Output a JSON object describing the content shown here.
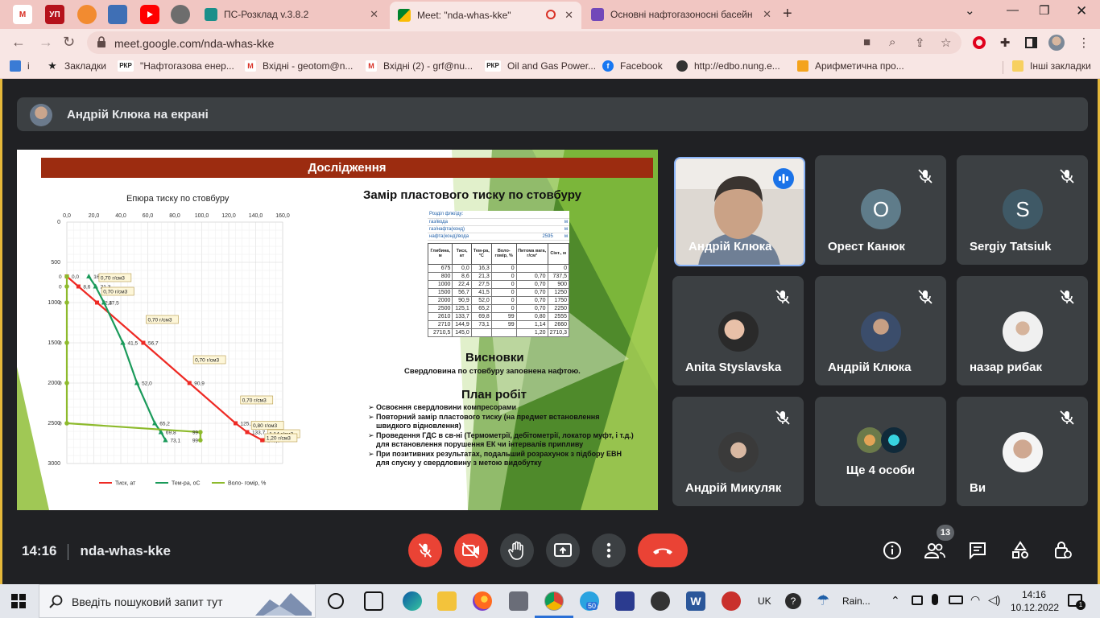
{
  "browser": {
    "tabs": [
      {
        "title": "ПС-Розклад v.3.8.2",
        "active": false
      },
      {
        "title": "Meet: \"nda-whas-kke\"",
        "active": true
      },
      {
        "title": "Основні нафтогазоносні басейн",
        "active": false
      }
    ],
    "pinned_labels": [
      "M",
      "УП",
      "",
      "",
      "",
      ""
    ],
    "url": "meet.google.com/nda-whas-kke",
    "bookmarks": [
      {
        "label": "і",
        "icon": "apps-icon"
      },
      {
        "label": "Закладки",
        "icon": "star-icon"
      },
      {
        "label": "\"Нафтогазова енер...",
        "icon": "РКР"
      },
      {
        "label": "Вхідні - geotom@n...",
        "icon": "M"
      },
      {
        "label": "Вхідні (2) - grf@nu...",
        "icon": "M"
      },
      {
        "label": "Oil and Gas Power...",
        "icon": "РКР"
      },
      {
        "label": "Facebook",
        "icon": "facebook-icon"
      },
      {
        "label": "http://edbo.nung.e...",
        "icon": "globe-icon"
      },
      {
        "label": "Арифметична про...",
        "icon": "vr-icon"
      },
      {
        "label": "Інші закладки",
        "icon": "folder-icon"
      }
    ]
  },
  "meet": {
    "presenter_banner": "Андрій Клюка на екрані",
    "meeting_code": "nda-whas-kke",
    "time": "14:16",
    "participants_count": "13",
    "tiles": [
      {
        "name": "Андрій Клюка",
        "type": "video",
        "speaking": true
      },
      {
        "name": "Орест Канюк",
        "type": "letter",
        "letter": "О",
        "color": "#5f7c8a",
        "muted": true
      },
      {
        "name": "Sergiy Tatsiuk",
        "type": "letter",
        "letter": "S",
        "color": "#3f5966",
        "muted": true
      },
      {
        "name": "Anita Styslavska",
        "type": "photo",
        "muted": true
      },
      {
        "name": "Андрій Клюка",
        "type": "photo",
        "muted": true
      },
      {
        "name": "назар рибак",
        "type": "photo",
        "muted": true
      },
      {
        "name": "Андрій Микуляк",
        "type": "photo",
        "muted": true
      },
      {
        "name": "Ще 4 особи",
        "type": "group",
        "muted": false
      },
      {
        "name": "Ви",
        "type": "photo",
        "muted": true
      }
    ]
  },
  "slide": {
    "header": "Дослідження",
    "chart_title": "Епюра тиску по стовбуру",
    "right_title": "Замір пластового тиску по стовбуру",
    "table_header_rows": [
      [
        "Розділ флюїду:",
        "",
        ""
      ],
      [
        "газ/вода",
        "",
        "м"
      ],
      [
        "газ/нафта(конд)",
        "",
        "м"
      ],
      [
        "нафта(конд)/вода",
        "2595",
        "м"
      ]
    ],
    "table_columns": [
      "Глибина, м",
      "Тиск, ат",
      "Тем-ра, °С",
      "Воло-гоміp, %",
      "Питома вага, г/см³",
      "Сінт., м"
    ],
    "table_rows": [
      [
        "675",
        "0,0",
        "16,3",
        "0",
        "",
        "0"
      ],
      [
        "800",
        "8,6",
        "21,3",
        "0",
        "0,70",
        "737,5"
      ],
      [
        "1000",
        "22,4",
        "27,5",
        "0",
        "0,70",
        "900"
      ],
      [
        "1500",
        "56,7",
        "41,5",
        "0",
        "0,70",
        "1250"
      ],
      [
        "2000",
        "90,9",
        "52,0",
        "0",
        "0,70",
        "1750"
      ],
      [
        "2500",
        "125,1",
        "65,2",
        "0",
        "0,70",
        "2250"
      ],
      [
        "2610",
        "133,7",
        "69,8",
        "99",
        "0,80",
        "2555"
      ],
      [
        "2710",
        "144,9",
        "73,1",
        "99",
        "1,14",
        "2660"
      ],
      [
        "2710,5",
        "145,0",
        "",
        "",
        "1,20",
        "2710,3"
      ]
    ],
    "conclusions_title": "Висновки",
    "conclusions_text": "Свердловина по стовбуру заповнена нафтою.",
    "plan_title": "План робіт",
    "plan_items": [
      "Освоєння свердловини компресорами",
      "Повторний замір пластового тиску (на предмет встановлення швидкого відновлення)",
      "Проведення ГДС в св-ні (Термометрії, дебітометрії, локатор муфт, і т.д.) для встановлення порушення ЕК чи інтервалів припливу",
      "При позитивних результатах, подальший розрахунок з підбору ЕВН для спуску у свердловину з метою видобутку"
    ]
  },
  "chart_data": {
    "type": "line",
    "title": "Епюра тиску по стовбуру",
    "x_ticks": [
      "0,0",
      "20,0",
      "40,0",
      "60,0",
      "80,0",
      "100,0",
      "120,0",
      "140,0",
      "160,0"
    ],
    "y_ticks": [
      "0",
      "500",
      "1000",
      "1500",
      "2000",
      "2500",
      "3000"
    ],
    "xlim": [
      0,
      160
    ],
    "ylim": [
      0,
      3000
    ],
    "y_inverted": true,
    "x_axis_position": "top",
    "grid": true,
    "legend_position": "bottom",
    "series": [
      {
        "name": "Тиск, ат",
        "color": "#ee2a24",
        "marker": "square",
        "points": [
          [
            0,
            675
          ],
          [
            8.6,
            800
          ],
          [
            22.4,
            1000
          ],
          [
            56.7,
            1500
          ],
          [
            90.9,
            2000
          ],
          [
            125.1,
            2500
          ],
          [
            133.7,
            2610
          ],
          [
            144.9,
            2710
          ],
          [
            145,
            2710.5
          ]
        ],
        "labels": [
          "0,0",
          "8,6",
          "22,4",
          "56,7",
          "90,9",
          "125,1",
          "133,7",
          "144,9",
          "145,0"
        ]
      },
      {
        "name": "Тем-ра, оС",
        "color": "#1a9a5a",
        "marker": "triangle",
        "points": [
          [
            16.3,
            675
          ],
          [
            21.3,
            800
          ],
          [
            27.5,
            1000
          ],
          [
            41.5,
            1500
          ],
          [
            52,
            2000
          ],
          [
            65.2,
            2500
          ],
          [
            69.8,
            2610
          ],
          [
            73.1,
            2710
          ]
        ],
        "labels": [
          "16,3",
          "21,3",
          "27,5",
          "41,5",
          "52,0",
          "65,2",
          "69,8",
          "73,1"
        ]
      },
      {
        "name": "Воло- гоміp, %",
        "color": "#8dba2c",
        "marker": "circle",
        "points": [
          [
            0,
            675
          ],
          [
            0,
            800
          ],
          [
            0,
            1000
          ],
          [
            0,
            1500
          ],
          [
            0,
            2000
          ],
          [
            0,
            2500
          ],
          [
            99,
            2610
          ],
          [
            99,
            2710
          ]
        ],
        "labels": [
          "0",
          "0",
          "0",
          "0",
          "0",
          "0",
          "99",
          "99"
        ]
      }
    ],
    "annotations": [
      {
        "text": "0,70 г/см3",
        "x": 25,
        "y": 720
      },
      {
        "text": "0,70 г/см3",
        "x": 27,
        "y": 890
      },
      {
        "text": "0,70 г/см3",
        "x": 60,
        "y": 1240
      },
      {
        "text": "0,70 г/см3",
        "x": 95,
        "y": 1740
      },
      {
        "text": "0,70 г/см3",
        "x": 130,
        "y": 2240
      },
      {
        "text": "0,80 г/см3",
        "x": 138,
        "y": 2555
      },
      {
        "text": "1,14 г/см3",
        "x": 150,
        "y": 2660
      },
      {
        "text": "1,20 г/см3",
        "x": 148,
        "y": 2710
      }
    ]
  },
  "taskbar": {
    "search_placeholder": "Введіть пошуковий запит тут",
    "lang": "UK",
    "weather": "Rain...",
    "time": "14:16",
    "date": "10.12.2022",
    "notif_count": "1",
    "app_badge": "50"
  }
}
